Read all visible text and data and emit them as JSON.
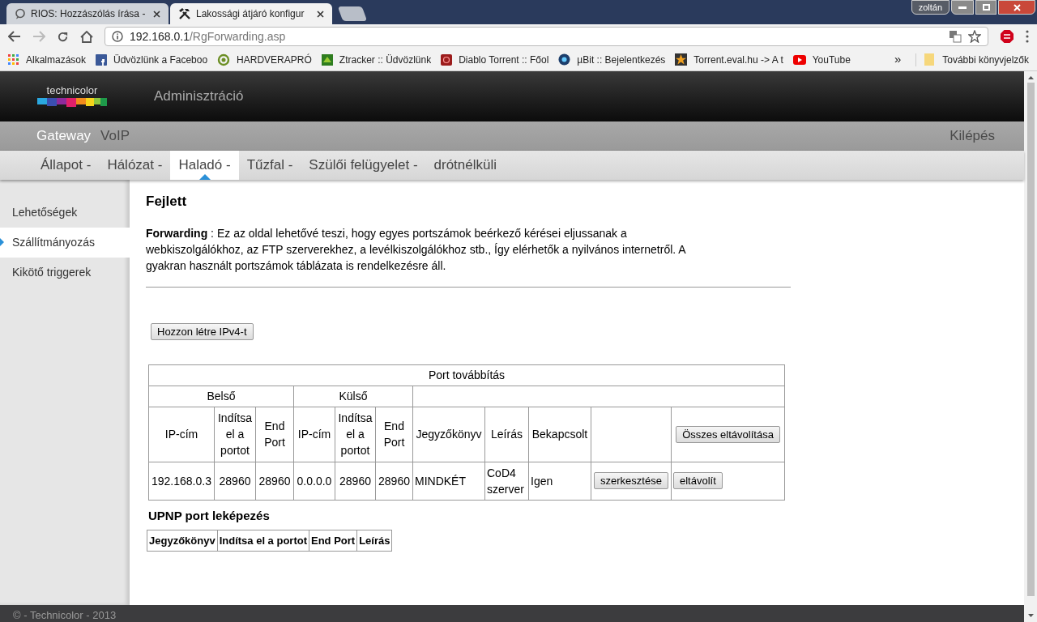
{
  "browser": {
    "tabs": [
      {
        "title": "RIOS: Hozzászólás írása -",
        "selected": false
      },
      {
        "title": "Lakossági átjáró konfigur",
        "selected": true
      }
    ],
    "profile": "zoltán",
    "address": {
      "host": "192.168.0.1",
      "path": "/RgForwarding.asp"
    },
    "bookmarks": [
      {
        "label": "Alkalmazások"
      },
      {
        "label": "Üdvözlünk a Faceboo"
      },
      {
        "label": "HARDVERAPRÓ"
      },
      {
        "label": "Ztracker :: Üdvözlünk"
      },
      {
        "label": "Diablo Torrent :: Főol"
      },
      {
        "label": "µBit :: Bejelentkezés"
      },
      {
        "label": "Torrent.eval.hu -> A t"
      },
      {
        "label": "YouTube"
      }
    ],
    "bookmarks_overflow": "»",
    "other_bookmarks": "További könyvjelzők"
  },
  "header": {
    "logo_text": "technicolor",
    "title": "Adminisztráció"
  },
  "top_nav": [
    {
      "label": "Gateway",
      "selected": true
    },
    {
      "label": "VoIP",
      "selected": false
    }
  ],
  "logout": "Kilépés",
  "sub_nav": [
    {
      "label": "Állapot -",
      "selected": false
    },
    {
      "label": "Hálózat -",
      "selected": false
    },
    {
      "label": "Haladó -",
      "selected": true
    },
    {
      "label": "Tűzfal -",
      "selected": false
    },
    {
      "label": "Szülői felügyelet -",
      "selected": false
    },
    {
      "label": "drótnélküli",
      "selected": false
    }
  ],
  "sidebar": [
    {
      "label": "Lehetőségek",
      "selected": false
    },
    {
      "label": "Szállítmányozás",
      "selected": true
    },
    {
      "label": "Kikötő triggerek",
      "selected": false
    }
  ],
  "content": {
    "heading": "Fejlett",
    "intro": "**Forwarding**  :  Ez az oldal lehetővé teszi, hogy egyes portszámok beérkező kérései eljussanak a webkiszolgálókhoz, az FTP szerverekhez, a levélkiszolgálókhoz stb., Így elérhetők a nyilvános internetről. A gyakran használt portszámok táblázata is rendelkezésre áll.",
    "create_button": "Hozzon létre IPv4-t"
  },
  "port_table": {
    "title": "Port továbbítás",
    "groups": [
      "Belső",
      "Külső"
    ],
    "columns": [
      "IP-cím",
      "Indítsa el a portot",
      "End Port",
      "IP-cím",
      "Indítsa el a portot",
      "End Port",
      "Jegyzőkönyv",
      "Leírás",
      "Bekapcsolt"
    ],
    "remove_all_button": "Összes eltávolítása",
    "rows": [
      {
        "cells": [
          "192.168.0.3",
          "28960",
          "28960",
          "0.0.0.0",
          "28960",
          "28960",
          "MINDKÉT",
          "CoD4 szerver",
          "Igen"
        ],
        "edit_button": "szerkesztése",
        "remove_button": "eltávolít"
      }
    ]
  },
  "upnp": {
    "title": "UPNP port leképezés",
    "columns": [
      "Jegyzőkönyv",
      "Indítsa el a portot",
      "End Port",
      "Leírás"
    ]
  },
  "footer": "© - Technicolor - 2013"
}
